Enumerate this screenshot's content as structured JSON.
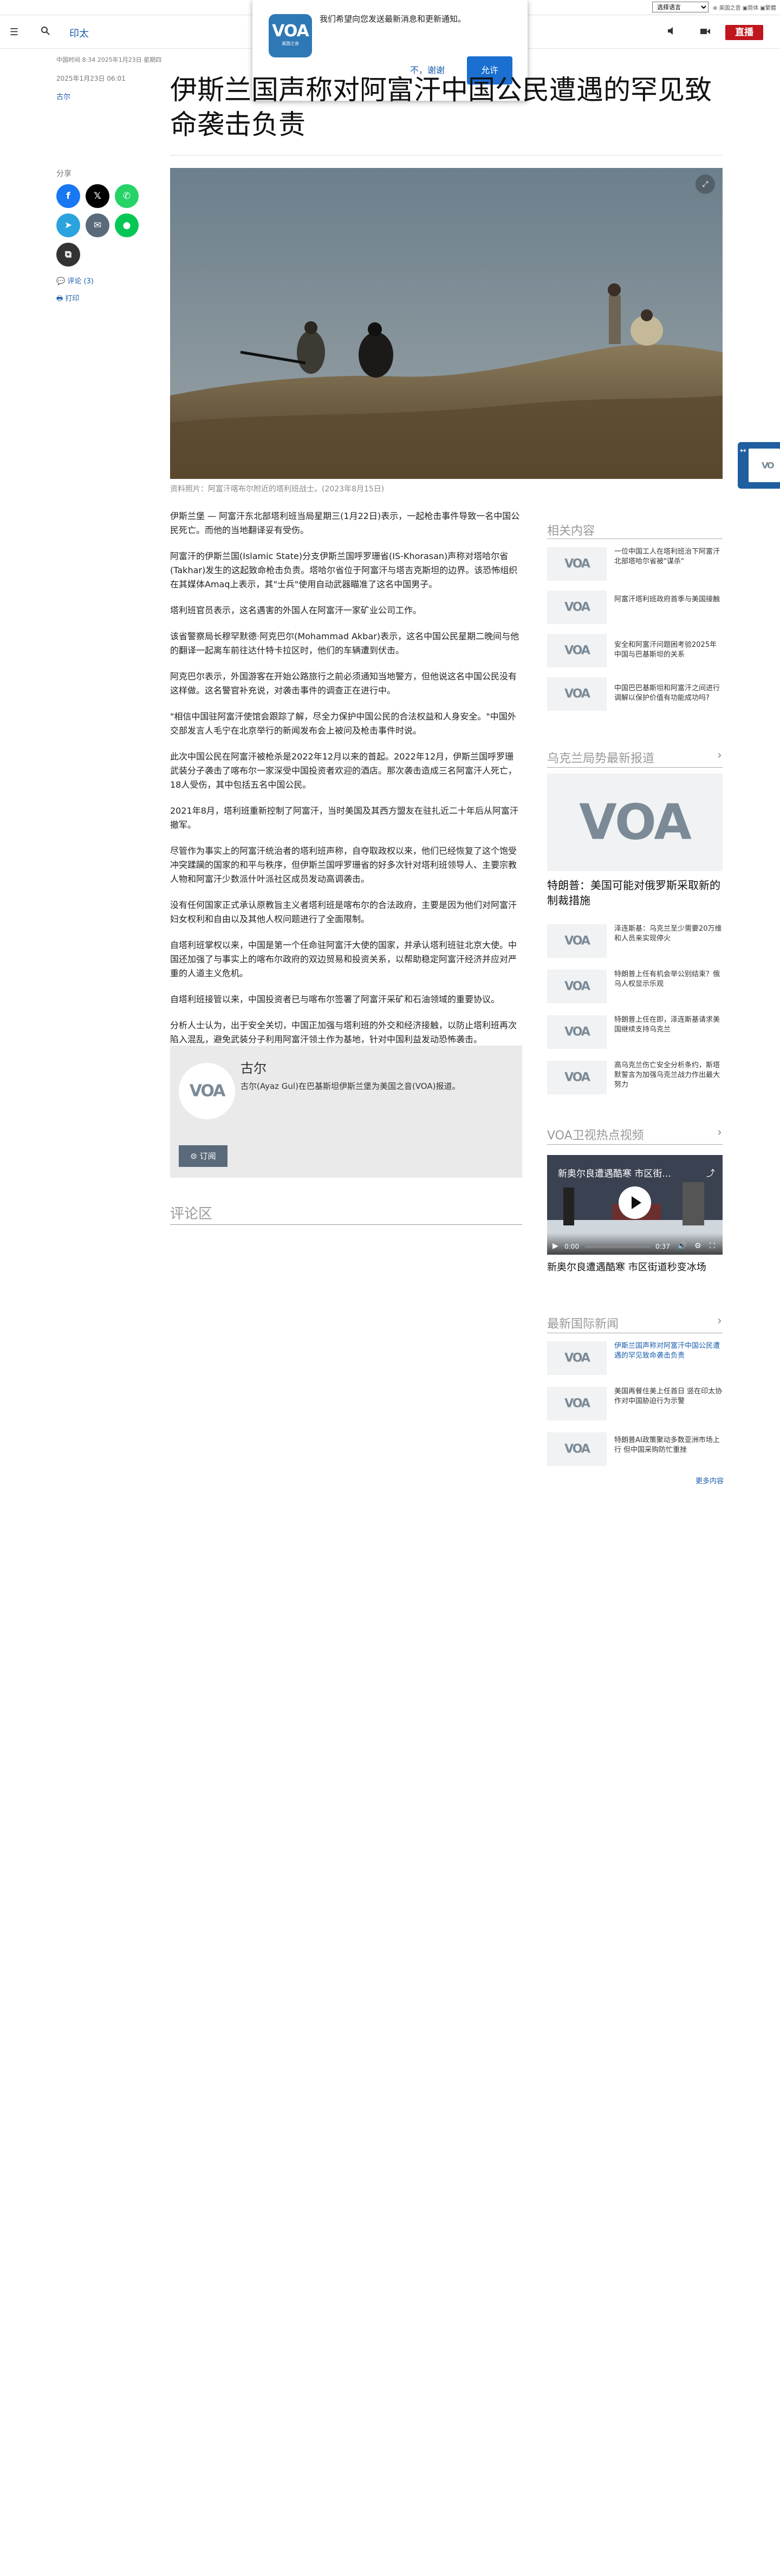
{
  "topbar": {
    "language_select": "选择语言",
    "right_text": "⊕ 美国之音 ▣简体 ▣繁體"
  },
  "header": {
    "section": "印太",
    "live": "直播"
  },
  "notification": {
    "message": "我们希望向您发送最新消息和更新通知。",
    "decline": "不，谢谢",
    "accept": "允许",
    "logo_text": "VOA",
    "logo_sub": "美国之音"
  },
  "article": {
    "updated_time": "中国时间 8:34 2025年1月23日 星期四",
    "date": "2025年1月23日 06:01",
    "author": "古尔",
    "title": "伊斯兰国声称对阿富汗中国公民遭遇的罕见致命袭击负责",
    "share_label": "分享",
    "comments_link": "评论 (3)",
    "print_link": "打印",
    "caption": "资料照片：阿富汗喀布尔附近的塔利班战士。(2023年8月15日)",
    "paragraphs": [
      "伊斯兰堡 — 阿富汗东北部塔利班当局星期三(1月22日)表示，一起枪击事件导致一名中国公民死亡。而他的当地翻译妥有受伤。",
      "阿富汗的伊斯兰国(Islamic State)分支伊斯兰国呼罗珊省(IS-Khorasan)声称对塔哈尔省(Takhar)发生的这起致命枪击负责。塔哈尔省位于阿富汗与塔吉克斯坦的边界。该恐怖组织在其媒体Amaq上表示，其\"士兵\"使用自动武器瞄准了这名中国男子。",
      "塔利班官员表示，这名遇害的外国人在阿富汗一家矿业公司工作。",
      "该省警察局长穆罕默德·阿克巴尔(Mohammad Akbar)表示，这名中国公民星期二晚间与他的翻译一起离车前往达什特卡拉区时，他们的车辆遭到伏击。",
      "阿克巴尔表示，外国游客在开始公路旅行之前必须通知当地警方，但他说这名中国公民没有这样做。这名警官补充说，对袭击事件的调查正在进行中。",
      "\"相信中国驻阿富汗使馆会跟踪了解，尽全力保护中国公民的合法权益和人身安全。\"中国外交部发言人毛宁在北京举行的新闻发布会上被问及枪击事件时说。",
      "此次中国公民在阿富汗被枪杀是2022年12月以来的首起。2022年12月，伊斯兰国呼罗珊武装分子袭击了喀布尔一家深受中国投资者欢迎的酒店。那次袭击造成三名阿富汗人死亡，18人受伤，其中包括五名中国公民。",
      "2021年8月，塔利班重新控制了阿富汗，当时美国及其西方盟友在驻扎近二十年后从阿富汗撤军。",
      "尽管作为事实上的阿富汗统治者的塔利班声称，自夺取政权以来，他们已经恢复了这个饱受冲突蹂躏的国家的和平与秩序，但伊斯兰国呼罗珊省的好多次针对塔利班领导人、主要宗教人物和阿富汗少数派什叶派社区成员发动高调袭击。",
      "没有任何国家正式承认原教旨主义者塔利班是喀布尔的合法政府，主要是因为他们对阿富汗妇女权利和自由以及其他人权问题进行了全面限制。",
      "自塔利班掌权以来，中国是第一个任命驻阿富汗大使的国家，并承认塔利班驻北京大使。中国还加强了与事实上的喀布尔政府的双边贸易和投资关系，以帮助稳定阿富汗经济并应对严重的人道主义危机。",
      "自塔利班接管以来，中国投资者已与喀布尔签署了阿富汗采矿和石油领域的重要协议。",
      "分析人士认为，出于安全关切，中国正加强与塔利班的外交和经济接触，以防止塔利班再次陷入混乱，避免武装分子利用阿富汗领土作为基地，针对中国利益发动恐怖袭击。"
    ],
    "author_box": {
      "name": "古尔",
      "bio": "古尔(Ayaz Gul)在巴基斯坦伊斯兰堡为美国之音(VOA)报道。",
      "subscribe": "订阅"
    },
    "comments_title": "评论区"
  },
  "related": {
    "title": "相关内容",
    "items": [
      {
        "text": "一位中国工人在塔利班治下阿富汗北部塔哈尔省被\"谋杀\""
      },
      {
        "text": "阿富汗塔利班政府首季与美国接触"
      },
      {
        "text": "安全和阿富汗问题困考验2025年中国与巴基斯坦的关系"
      },
      {
        "text": "中国巴巴基斯坦和阿富汗之间进行调解以保护价值有功能成功吗?"
      }
    ]
  },
  "ukraine": {
    "title": "乌克兰局势最新报道",
    "featured": "特朗普：美国可能对俄罗斯采取新的制裁措施",
    "items": [
      {
        "text": "泽连斯基：乌克兰至少需要20万维和人员来实现停火"
      },
      {
        "text": "特朗普上任有机会举公别结束？俄乌人权显示乐观"
      },
      {
        "text": "特朗普上任在即，泽连斯基请求美国继续支持乌克兰"
      },
      {
        "text": "高乌克兰伤亡安全分析条约，斯塔默誓言为加强乌克兰战力作出最大努力"
      }
    ]
  },
  "video": {
    "section_title": "VOA卫视热点视频",
    "title": "新奥尔良遭遇酷寒 市区街...",
    "caption": "新奥尔良遭遇酷寒 市区街道秒变冰场",
    "time_current": "0:00",
    "time_total": "0:37"
  },
  "world_news": {
    "title": "最新国际新闻",
    "items": [
      {
        "text": "伊斯兰国声称对阿富汗中国公民遭遇的罕见致命袭击负责"
      },
      {
        "text": "美国再餐住美上任首日 竖在印太协作对中国胁迫行为示警"
      },
      {
        "text": "特朗普AI政策聚动多数亚洲市场上行 但中国采购防忙重挫"
      }
    ],
    "more": "更多内容"
  },
  "icons": {
    "menu": "menu-icon",
    "search": "search-icon",
    "audio": "speaker-icon",
    "video": "video-icon"
  },
  "colors": {
    "brand": "#1a5dab",
    "live": "#c0161d",
    "facebook": "#1877f2",
    "x": "#000000",
    "whatsapp": "#25d366",
    "telegram": "#2aa3df",
    "email": "#5a6a7a",
    "line": "#06c755"
  }
}
